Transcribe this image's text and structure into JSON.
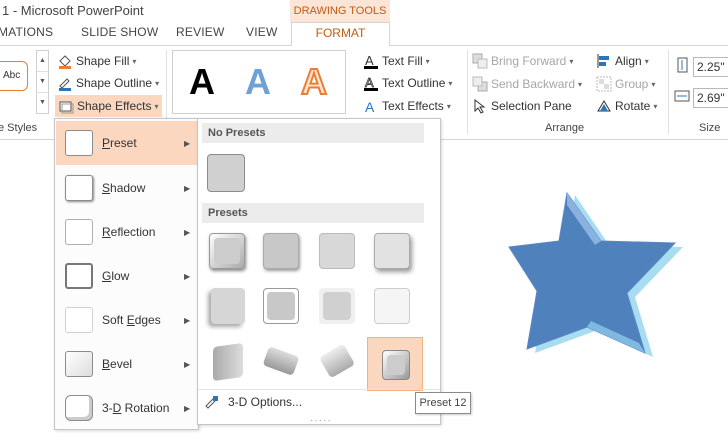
{
  "window": {
    "title": "1 - Microsoft PowerPoint"
  },
  "contextual": {
    "drawing_tools": "DRAWING TOOLS"
  },
  "tabs": {
    "animations": "MATIONS",
    "slide_show": "SLIDE SHOW",
    "review": "REVIEW",
    "view": "VIEW",
    "format": "FORMAT"
  },
  "ribbon": {
    "shape_styles": {
      "label": "e Styles",
      "thumb_text": "Abc",
      "shape_fill": "Shape Fill",
      "shape_outline": "Shape Outline",
      "shape_effects": "Shape Effects"
    },
    "wordart": {
      "sample": "A",
      "text_fill": "Text Fill",
      "text_outline": "Text Outline",
      "text_effects": "Text Effects"
    },
    "arrange": {
      "label": "Arrange",
      "bring_forward": "Bring Forward",
      "send_backward": "Send Backward",
      "selection_pane": "Selection Pane",
      "align": "Align",
      "group": "Group",
      "rotate": "Rotate"
    },
    "size": {
      "label": "Size",
      "height": "2.25\"",
      "width": "2.69\""
    }
  },
  "effects_menu": {
    "items": [
      {
        "label": "Preset",
        "mnemonic": "P",
        "rest": "reset"
      },
      {
        "label": "Shadow",
        "mnemonic": "S",
        "rest": "hadow"
      },
      {
        "label": "Reflection",
        "mnemonic": "R",
        "rest": "eflection"
      },
      {
        "label": "Glow",
        "mnemonic": "G",
        "rest": "low"
      },
      {
        "label": "Soft Edges",
        "pre": "Soft ",
        "mnemonic": "E",
        "rest": "dges"
      },
      {
        "label": "Bevel",
        "mnemonic": "B",
        "rest": "evel"
      },
      {
        "label": "3-D Rotation",
        "pre": "3-",
        "mnemonic": "D",
        "rest": " Rotation"
      }
    ]
  },
  "preset_submenu": {
    "no_presets": "No Presets",
    "presets": "Presets",
    "options": "3-D Options...",
    "tooltip": "Preset 12"
  },
  "colors": {
    "accent": "#c55a11",
    "hover": "#fbd7c0",
    "star_fill": "#4f81bd"
  }
}
